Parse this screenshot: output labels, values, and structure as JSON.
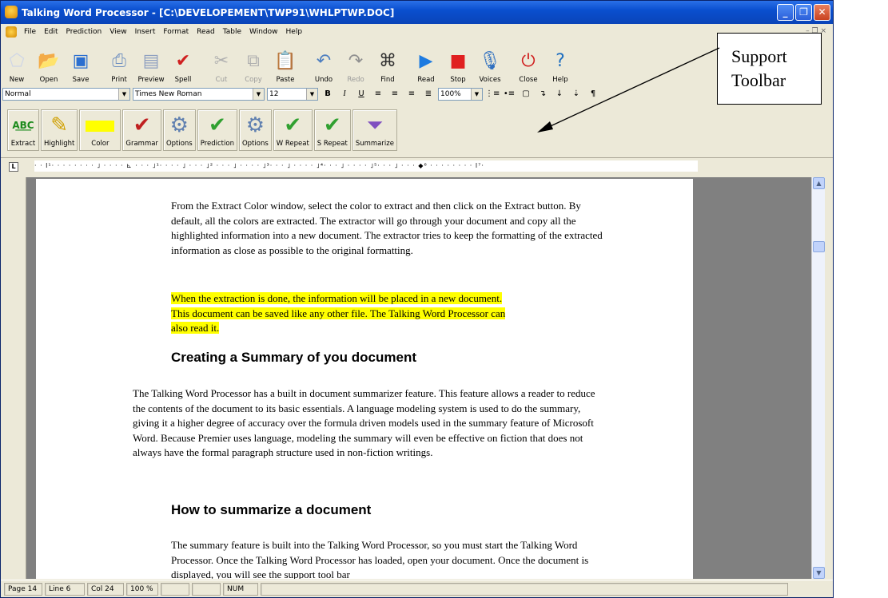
{
  "window": {
    "title": "Talking Word Processor - [C:\\DEVELOPEMENT\\TWP91\\WHLPTWP.DOC]"
  },
  "menu": [
    "File",
    "Edit",
    "Prediction",
    "View",
    "Insert",
    "Format",
    "Read",
    "Table",
    "Window",
    "Help"
  ],
  "toolbar": [
    {
      "label": "New",
      "icon": "new-document-icon"
    },
    {
      "label": "Open",
      "icon": "open-folder-icon"
    },
    {
      "label": "Save",
      "icon": "save-icon"
    },
    {
      "label": "Print",
      "icon": "print-icon"
    },
    {
      "label": "Preview",
      "icon": "preview-icon"
    },
    {
      "label": "Spell",
      "icon": "spell-check-icon"
    },
    {
      "label": "Cut",
      "icon": "cut-icon",
      "disabled": true
    },
    {
      "label": "Copy",
      "icon": "copy-icon",
      "disabled": true
    },
    {
      "label": "Paste",
      "icon": "paste-icon"
    },
    {
      "label": "Undo",
      "icon": "undo-icon"
    },
    {
      "label": "Redo",
      "icon": "redo-icon",
      "disabled": true
    },
    {
      "label": "Find",
      "icon": "binoculars-icon"
    },
    {
      "label": "Read",
      "icon": "play-icon"
    },
    {
      "label": "Stop",
      "icon": "stop-icon"
    },
    {
      "label": "Voices",
      "icon": "microphone-icon"
    },
    {
      "label": "Close",
      "icon": "power-icon"
    },
    {
      "label": "Help",
      "icon": "help-icon"
    }
  ],
  "format": {
    "style": "Normal",
    "font": "Times New Roman",
    "size": "12",
    "zoom": "100%"
  },
  "support_toolbar": [
    {
      "label": "Extract",
      "icon": "extract-abc-icon"
    },
    {
      "label": "Highlight",
      "icon": "highlighter-icon"
    },
    {
      "label": "Color",
      "icon": "color-swatch"
    },
    {
      "label": "Grammar",
      "icon": "grammar-icon"
    },
    {
      "label": "Options",
      "icon": "gears-icon"
    },
    {
      "label": "Prediction",
      "icon": "checkmark-icon"
    },
    {
      "label": "Options",
      "icon": "gears-icon"
    },
    {
      "label": "W Repeat",
      "icon": "checkmark-icon"
    },
    {
      "label": "S Repeat",
      "icon": "checkmark-icon"
    },
    {
      "label": "Summarize",
      "icon": "funnel-icon"
    }
  ],
  "ruler_text": "· · l¹· · · · · · · · ˩ · · · · ⊾ · · · ˩¹· · · · ˩ · · · ˩² · · · ˩ · · · · ˩³· · · ˩ · · · · ˩⁴· · · ˩ · · · · ˩⁵· · · ˩ · · · ◆⁶ · · · · · · · · l⁷·",
  "document": {
    "p1": "From the Extract Color window, select the color to extract and then click on the Extract button.  By default, all the colors are extracted.  The extractor will go through your document and copy all the highlighted information into a new document.  The extractor tries to keep the formatting of the extracted information as close as possible to the original formatting.",
    "p2_l1": "When the extraction is done, the information will be placed in a new document.",
    "p2_l2": "This document can be saved like any other file.  The Talking Word Processor can",
    "p2_l3": "also read it.",
    "h1": "Creating a Summary of you document",
    "p3": "The Talking Word Processor has a built in document summarizer feature. This feature allows a reader to reduce the contents of the document to its basic essentials. A language modeling system is used to do the summary, giving it a higher degree of accuracy over the formula driven models used in the summary feature of Microsoft Word.  Because Premier uses language, modeling the summary will even be effective on fiction that does not always have the formal paragraph structure used in non-fiction writings.",
    "h2": "How to summarize a document",
    "p4": "The summary feature is built into the Talking Word Processor, so you must start the Talking Word Processor.  Once the Talking Word Processor has loaded, open your document. Once the document is displayed, you will see the support tool bar"
  },
  "status": {
    "page": "Page 14",
    "line": "Line  6",
    "col": "Col 24",
    "zoom": "100 %",
    "num": "NUM"
  },
  "callout": {
    "line1": "Support",
    "line2": "Toolbar"
  }
}
